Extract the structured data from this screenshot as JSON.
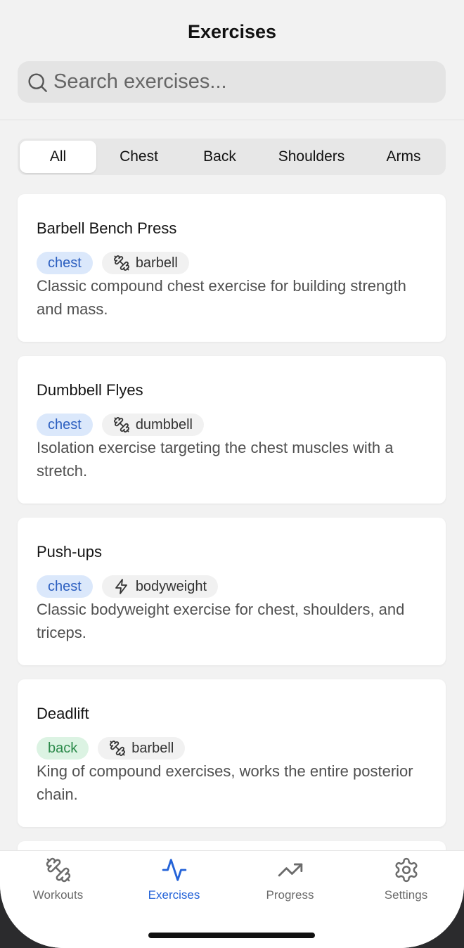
{
  "header": {
    "title": "Exercises",
    "search_placeholder": "Search exercises..."
  },
  "filters": [
    "All",
    "Chest",
    "Back",
    "Shoulders",
    "Arms"
  ],
  "active_filter": "All",
  "exercises": [
    {
      "name": "Barbell Bench Press",
      "muscle": "chest",
      "equipment": "barbell",
      "equipment_icon": "dumbbell-icon",
      "description": "Classic compound chest exercise for building strength and mass."
    },
    {
      "name": "Dumbbell Flyes",
      "muscle": "chest",
      "equipment": "dumbbell",
      "equipment_icon": "dumbbell-icon",
      "description": "Isolation exercise targeting the chest muscles with a stretch."
    },
    {
      "name": "Push-ups",
      "muscle": "chest",
      "equipment": "bodyweight",
      "equipment_icon": "lightning-icon",
      "description": "Classic bodyweight exercise for chest, shoulders, and triceps."
    },
    {
      "name": "Deadlift",
      "muscle": "back",
      "equipment": "barbell",
      "equipment_icon": "dumbbell-icon",
      "description": "King of compound exercises, works the entire posterior chain."
    }
  ],
  "tabbar": [
    {
      "label": "Workouts",
      "icon": "dumbbell-icon",
      "active": false
    },
    {
      "label": "Exercises",
      "icon": "activity-icon",
      "active": true
    },
    {
      "label": "Progress",
      "icon": "trending-up-icon",
      "active": false
    },
    {
      "label": "Settings",
      "icon": "gear-icon",
      "active": false
    }
  ],
  "colors": {
    "accent": "#2463d8",
    "chest_tag_bg": "#dbe8fb",
    "chest_tag_text": "#2c5fc0",
    "back_tag_bg": "#dcf3e3",
    "back_tag_text": "#2b8a4a"
  }
}
